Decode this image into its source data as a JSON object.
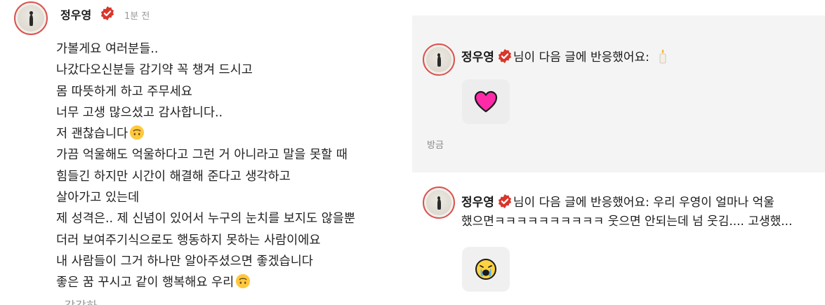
{
  "post": {
    "author": "정우영",
    "time": "1분 전",
    "lines": [
      "가볼게요 여러분들..",
      "나갔다오신분들 감기약 꼭 챙겨 드시고",
      "몸 따뜻하게 하고 주무세요",
      "너무 고생 많으셨고 감사합니다..",
      "저 괜찮습니다",
      "가끔 억울해도 억울하다고 그런 거 아니라고 말을 못할 때",
      "힘들긴 하지만 시간이 해결해 준다고 생각하고",
      "살아가고 있는데",
      "제 성격은.. 제 신념이 있어서 누구의 눈치를 보지도 않을뿐",
      "더러 보여주기식으로도 행동하지 못하는 사람이에요",
      "내 사람들이 그거 하나만 알아주셨으면 좋겠습니다",
      "좋은 꿈 꾸시고 같이 행복해요 우리"
    ],
    "cut_line": "- 감감하"
  },
  "notifications": [
    {
      "author": "정우영",
      "text": "님이 다음 글에 반응했어요:",
      "reaction_icon": "heart-icon",
      "time": "방금"
    },
    {
      "author": "정우영",
      "text_line1": "님이 다음 글에 반응했어요: 우리 우영이 얼마나 억울",
      "text_line2": "했으면ㅋㅋㅋㅋㅋㅋㅋㅋㅋㅋ 웃으면 안되는데 넘 웃김.... 고생했...",
      "reaction_icon": "crying-face-icon"
    }
  ],
  "colors": {
    "verify_badge": "#d9362b",
    "heart": "#ff2aa8",
    "panel_bg": "#f4f4f4"
  }
}
